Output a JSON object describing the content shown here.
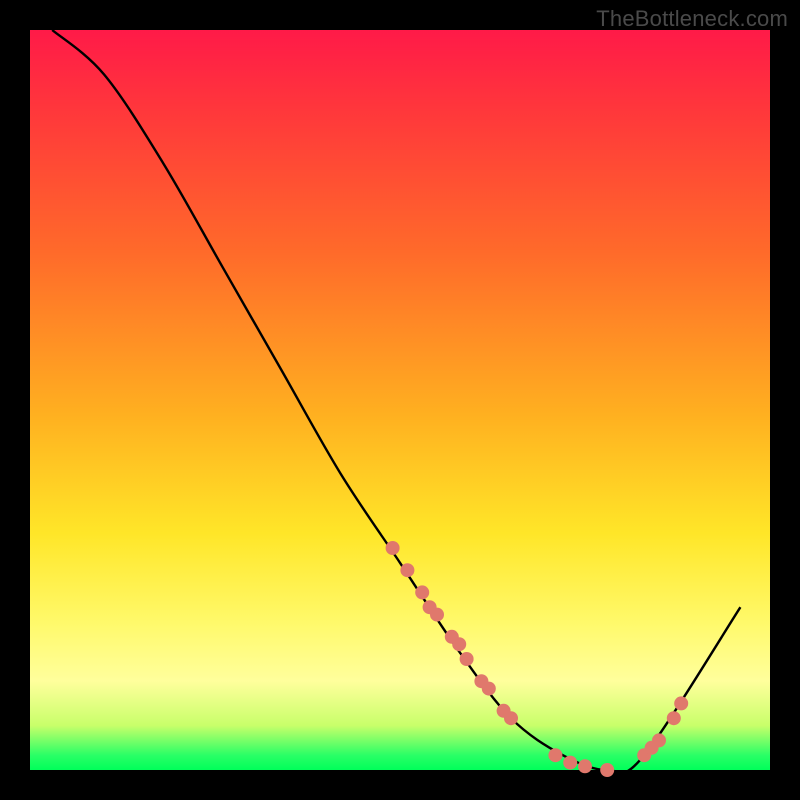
{
  "attribution": "TheBottleneck.com",
  "chart_data": {
    "type": "line",
    "title": "",
    "xlabel": "",
    "ylabel": "",
    "xlim": [
      0,
      100
    ],
    "ylim": [
      0,
      100
    ],
    "series": [
      {
        "name": "bottleneck-curve",
        "x": [
          3,
          10,
          18,
          26,
          34,
          42,
          50,
          58,
          65,
          72,
          78,
          83,
          96
        ],
        "values": [
          100,
          94,
          82,
          68,
          54,
          40,
          28,
          16,
          7,
          2,
          0,
          2,
          22
        ]
      }
    ],
    "markers": {
      "name": "data-points",
      "color": "#e0786c",
      "x": [
        49,
        51,
        53,
        54,
        55,
        57,
        58,
        59,
        61,
        62,
        64,
        65,
        71,
        73,
        75,
        78,
        83,
        84,
        85,
        87,
        88
      ],
      "values": [
        30,
        27,
        24,
        22,
        21,
        18,
        17,
        15,
        12,
        11,
        8,
        7,
        2,
        1,
        0.5,
        0,
        2,
        3,
        4,
        7,
        9
      ]
    },
    "background_gradient": {
      "stops": [
        {
          "pos": 0,
          "color": "#ff1a48"
        },
        {
          "pos": 30,
          "color": "#ff6a2a"
        },
        {
          "pos": 68,
          "color": "#ffe628"
        },
        {
          "pos": 94,
          "color": "#c8ff6a"
        },
        {
          "pos": 100,
          "color": "#00ff5a"
        }
      ]
    }
  }
}
